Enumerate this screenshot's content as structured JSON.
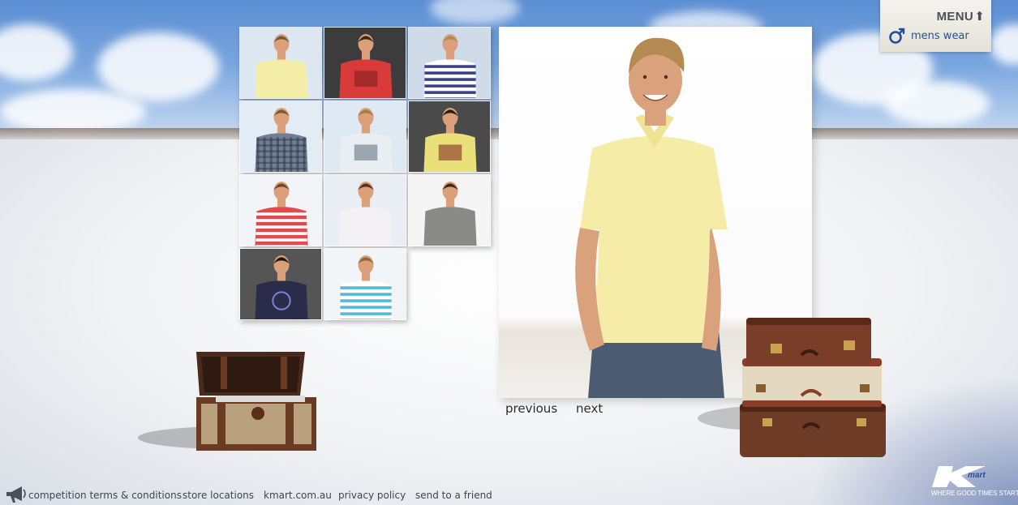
{
  "menu": {
    "label": "MENU",
    "arrow": "⬆",
    "section": "mens wear",
    "section_icon": "male-icon",
    "accent": "#20509b"
  },
  "thumbnails": [
    {
      "shirt": "#f3eda8",
      "bg": "#dde7f2",
      "hair": "#7a5a35",
      "pattern": "plain"
    },
    {
      "shirt": "#d93a3a",
      "bg": "#3c3c3c",
      "hair": "#3b2a1c",
      "pattern": "graphic"
    },
    {
      "shirt": "#ffffff",
      "bg": "#cfdbe9",
      "hair": "#b08a55",
      "pattern": "navy-stripes"
    },
    {
      "shirt": "#6f7f96",
      "bg": "#e3ebf4",
      "hair": "#7a5a35",
      "pattern": "check"
    },
    {
      "shirt": "#e8eef2",
      "bg": "#dfe9f4",
      "hair": "#a07a48",
      "pattern": "graphic-grey"
    },
    {
      "shirt": "#e9e07a",
      "bg": "#4a4a4a",
      "hair": "#2a1d14",
      "pattern": "graphic"
    },
    {
      "shirt": "#e14a4f",
      "bg": "#f2f4f7",
      "hair": "#6b4a2c",
      "pattern": "red-stripes"
    },
    {
      "shirt": "#f3f1f5",
      "bg": "#e9eef4",
      "hair": "#4a3526",
      "pattern": "plain"
    },
    {
      "shirt": "#8a8a86",
      "bg": "#f5f5f5",
      "hair": "#3a2a1e",
      "pattern": "plain"
    },
    {
      "shirt": "#2b2b4a",
      "bg": "#555555",
      "hair": "#1f1a16",
      "pattern": "hoodie"
    },
    {
      "shirt": "#ffffff",
      "bg": "#f2f5f8",
      "hair": "#8c6a40",
      "pattern": "blue-stripes"
    }
  ],
  "main_photo": {
    "shirt": "#f5eda7",
    "jeans": "#4b5b72",
    "skin": "#d9a27c",
    "hair": "#b48a52"
  },
  "nav": {
    "previous": "previous",
    "next": "next"
  },
  "footer": {
    "icon": "megaphone-icon",
    "links": [
      "competition terms & conditions",
      "store locations",
      "kmart.com.au",
      "privacy policy",
      "send to a friend"
    ]
  },
  "brand": {
    "tagline": "WHERE GOOD TIMES START",
    "logo": "kmart-logo"
  }
}
